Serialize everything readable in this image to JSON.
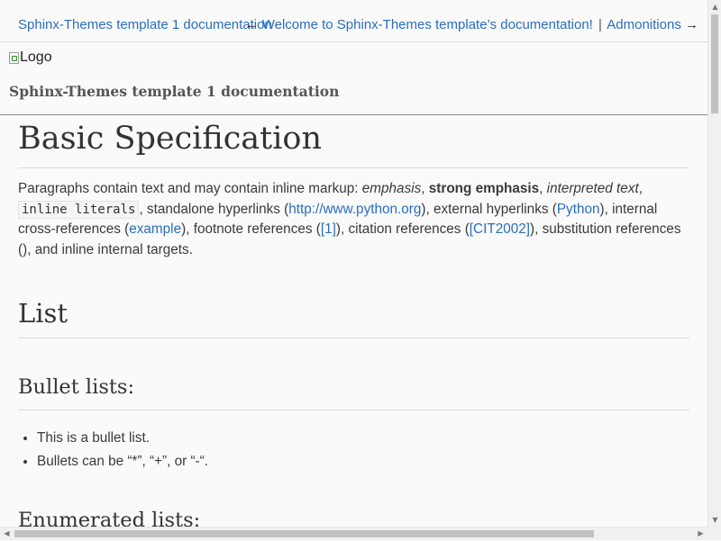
{
  "nav": {
    "home": "Sphinx-Themes template 1 documentation",
    "prev_arrow": "←",
    "prev": "Welcome to Sphinx-Themes template’s documentation!",
    "separator": "|",
    "next": "Admonitions",
    "next_arrow": "→"
  },
  "header": {
    "logo_alt": "Logo",
    "title": "Sphinx-Themes template 1 documentation"
  },
  "content": {
    "title": "Basic Specification",
    "paragraph": {
      "t1": "Paragraphs contain text and may contain inline markup: ",
      "emphasis": "emphasis",
      "t2": ", ",
      "strong": "strong emphasis",
      "t3": ", ",
      "interpreted": "interpreted text",
      "t4": ", ",
      "literal": "inline literals",
      "t5": ", standalone hyperlinks (",
      "link_python_org": "http://www.python.org",
      "t6": "), external hyperlinks (",
      "link_python": "Python",
      "t7": "), internal cross-references (",
      "link_example": "example",
      "t8": "), footnote references (",
      "link_footnote": "[1]",
      "t9": "), citation references (",
      "link_citation": "[CIT2002]",
      "t10": "), substitution references (), and inline internal targets."
    },
    "section_list": "List",
    "section_bullets": "Bullet lists:",
    "bullets": [
      "This is a bullet list.",
      "Bullets can be “*”, “+”, or “-“."
    ],
    "section_enumerated": "Enumerated lists:"
  },
  "scrollbars": {
    "up": "▲",
    "down": "▼",
    "left": "◀",
    "right": "▶"
  }
}
